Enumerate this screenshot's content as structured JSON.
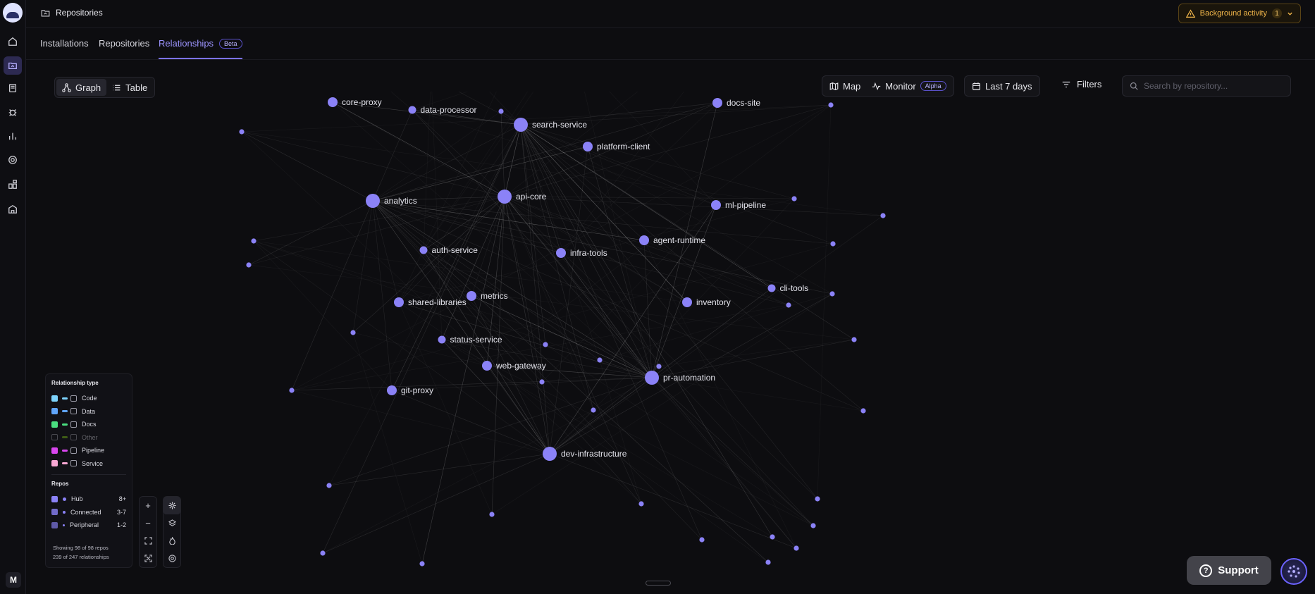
{
  "header": {
    "breadcrumb": "Repositories",
    "background_activity": {
      "label": "Background activity",
      "count": "1"
    }
  },
  "tabs": [
    {
      "label": "Installations"
    },
    {
      "label": "Repositories"
    },
    {
      "label": "Relationships",
      "badge": "Beta"
    }
  ],
  "view_toggle": {
    "graph": "Graph",
    "table": "Table"
  },
  "toolbar": {
    "map": "Map",
    "monitor": "Monitor",
    "monitor_badge": "Alpha",
    "date_range": "Last 7 days",
    "filters": "Filters",
    "search_placeholder": "Search by repository..."
  },
  "graph": {
    "node_color": "#8b82f7",
    "labeled_nodes": [
      {
        "label": "core-proxy",
        "type": "Connected",
        "pos": [
          472,
          145
        ]
      },
      {
        "label": "data-processor",
        "type": "Peripheral",
        "pos": [
          585,
          156
        ]
      },
      {
        "label": "search-service",
        "type": "Hub",
        "pos": [
          739,
          177
        ]
      },
      {
        "label": "platform-client",
        "type": "Connected",
        "pos": [
          834,
          208
        ]
      },
      {
        "label": "docs-site",
        "type": "Connected",
        "pos": [
          1018,
          146
        ]
      },
      {
        "label": "analytics",
        "type": "Hub",
        "pos": [
          529,
          285
        ]
      },
      {
        "label": "api-core",
        "type": "Hub",
        "pos": [
          716,
          279
        ]
      },
      {
        "label": "ml-pipeline",
        "type": "Connected",
        "pos": [
          1016,
          291
        ]
      },
      {
        "label": "agent-runtime",
        "type": "Connected",
        "pos": [
          914,
          341
        ]
      },
      {
        "label": "auth-service",
        "type": "Peripheral",
        "pos": [
          601,
          355
        ]
      },
      {
        "label": "infra-tools",
        "type": "Connected",
        "pos": [
          796,
          359
        ]
      },
      {
        "label": "cli-tools",
        "type": "Peripheral",
        "pos": [
          1095,
          409
        ]
      },
      {
        "label": "shared-libraries",
        "type": "Connected",
        "pos": [
          566,
          429
        ]
      },
      {
        "label": "metrics",
        "type": "Connected",
        "pos": [
          669,
          420
        ]
      },
      {
        "label": "inventory",
        "type": "Connected",
        "pos": [
          975,
          429
        ]
      },
      {
        "label": "status-service",
        "type": "Peripheral",
        "pos": [
          627,
          482
        ]
      },
      {
        "label": "web-gateway",
        "type": "Connected",
        "pos": [
          691,
          519
        ]
      },
      {
        "label": "pr-automation",
        "type": "Hub",
        "pos": [
          925,
          536
        ]
      },
      {
        "label": "git-proxy",
        "type": "Connected",
        "pos": [
          556,
          554
        ]
      },
      {
        "label": "dev-infrastructure",
        "type": "Hub",
        "pos": [
          780,
          644
        ]
      }
    ]
  },
  "legend": {
    "relationship_title": "Relationship type",
    "relationship_types": [
      {
        "label": "Code",
        "color": "#7dd3fc",
        "enabled": true
      },
      {
        "label": "Data",
        "color": "#60a5fa",
        "enabled": true
      },
      {
        "label": "Docs",
        "color": "#4ade80",
        "enabled": true
      },
      {
        "label": "Other",
        "color": "#84cc16",
        "enabled": false
      },
      {
        "label": "Pipeline",
        "color": "#d946ef",
        "enabled": true
      },
      {
        "label": "Service",
        "color": "#f9a8d4",
        "enabled": true
      }
    ],
    "repos_title": "Repos",
    "repos": [
      {
        "label": "Hub",
        "range": "8+"
      },
      {
        "label": "Connected",
        "range": "3-7"
      },
      {
        "label": "Peripheral",
        "range": "1-2"
      }
    ],
    "showing_repos": "Showing 98 of 98 repos",
    "showing_relationships": "239 of 247 relationships"
  },
  "support": {
    "label": "Support"
  },
  "user": {
    "initial": "M"
  }
}
